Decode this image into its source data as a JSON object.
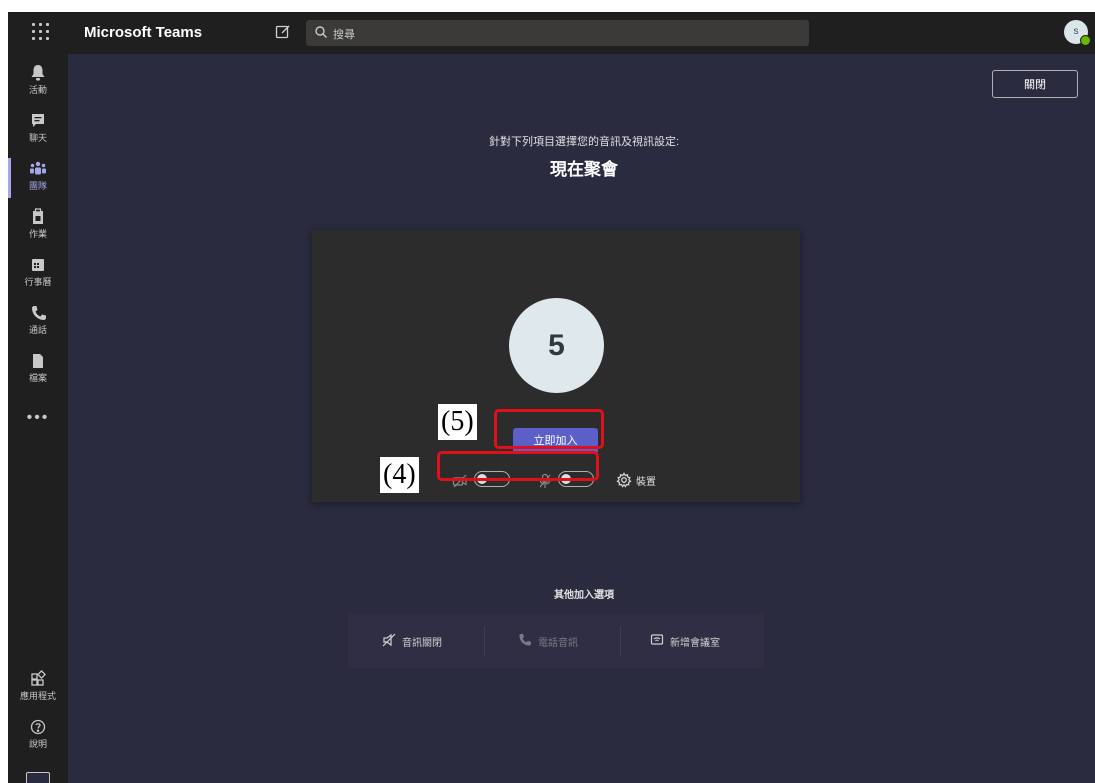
{
  "topbar": {
    "app_title": "Microsoft Teams",
    "search_placeholder": "搜尋",
    "avatar_initial": "s"
  },
  "rail": {
    "items": [
      {
        "label": "活動",
        "icon": "bell-icon"
      },
      {
        "label": "聊天",
        "icon": "chat-icon"
      },
      {
        "label": "團隊",
        "icon": "teams-icon",
        "active": true
      },
      {
        "label": "作業",
        "icon": "assignments-icon"
      },
      {
        "label": "行事曆",
        "icon": "calendar-icon"
      },
      {
        "label": "通話",
        "icon": "phone-icon"
      },
      {
        "label": "檔案",
        "icon": "file-icon"
      }
    ],
    "more": "•••",
    "apps_label": "應用程式",
    "help_label": "說明"
  },
  "main": {
    "close_label": "關閉",
    "subtitle": "針對下列項目選擇您的音訊及視訊設定:",
    "meeting_title": "現在聚會",
    "avatar_number": "5",
    "join_label": "立即加入",
    "devices_label": "裝置",
    "camera_on": false,
    "mic_on": false,
    "other_options_label": "其他加入選項",
    "options": {
      "audio_off": "音訊關閉",
      "phone_audio": "電話音訊",
      "add_room": "新增會議室"
    }
  },
  "annotations": {
    "tag_join": "(5)",
    "tag_controls": "(4)",
    "highlight_color": "#e0101a"
  },
  "colors": {
    "accent": "#5b5fc7",
    "rail_active": "#a5a7e8",
    "background": "#2b2b40",
    "bar": "#1f1f1f"
  }
}
